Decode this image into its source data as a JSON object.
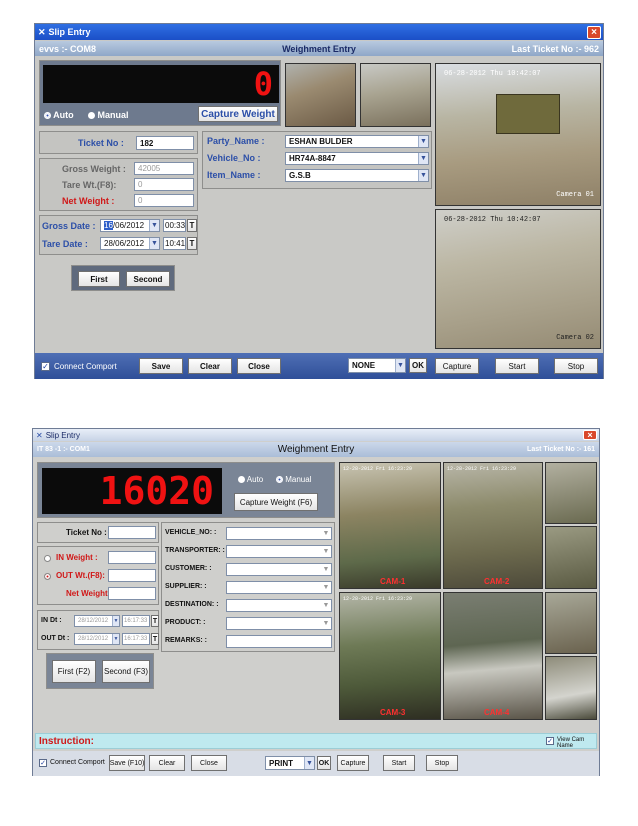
{
  "top": {
    "title": "Slip Entry",
    "header_left": "evvs :- COM8",
    "header_center": "Weighment Entry",
    "header_right": "Last Ticket No :- 962",
    "display_value": "0",
    "mode_auto": "Auto",
    "mode_manual": "Manual",
    "capture_weight": "Capture Weight",
    "ticket_label": "Ticket No :",
    "ticket_value": "182",
    "gross_label": "Gross Weight :",
    "gross_value": "42005",
    "tare_label": "Tare Wt.(F8):",
    "tare_value": "0",
    "net_label": "Net Weight :",
    "net_value": "0",
    "gross_date_label": "Gross Date :",
    "gross_date_day": "16",
    "gross_date_rest": "/06/2012",
    "gross_time": "00:33",
    "tare_date_label": "Tare Date :",
    "tare_date": "28/06/2012",
    "tare_time": "10:41",
    "t_btn": "T",
    "first": "First",
    "second": "Second",
    "party_label": "Party_Name :",
    "party_value": "ESHAN BULDER",
    "vehicle_label": "Vehicle_No :",
    "vehicle_value": "HR74A-8847",
    "item_label": "Item_Name :",
    "item_value": "G.S.B",
    "cam1_stamp": "06-28-2012 Thu 10:42:07",
    "cam1_name": "Camera 01",
    "cam2_stamp": "06-28-2012 Thu 10:42:07",
    "cam2_name": "Camera 02",
    "connect": "Connect Comport",
    "save": "Save",
    "clear": "Clear",
    "close": "Close",
    "printer": "NONE",
    "ok": "OK",
    "capture": "Capture",
    "start": "Start",
    "stop": "Stop"
  },
  "bottom": {
    "title": "Slip Entry",
    "header_left": "IT 83 -1 :- COM1",
    "header_center": "Weighment Entry",
    "header_right": "Last Ticket No :- 161",
    "display_value": "16020",
    "mode_auto": "Auto",
    "mode_manual": "Manual",
    "capture_weight": "Capture Weight (F6)",
    "ticket_label": "Ticket No :",
    "in_label": "IN Weight :",
    "out_label": "OUT Wt.(F8):",
    "net_label": "Net Weight :",
    "in_dt_label": "IN Dt :",
    "in_date": "28/12/2012",
    "in_time": "16:17:33",
    "out_dt_label": "OUT Dt :",
    "out_date": "28/12/2012",
    "out_time": "16:17:33",
    "t_btn": "T",
    "first": "First (F2)",
    "second": "Second (F3)",
    "fields": [
      "VEHICLE_NO: :",
      "TRANSPORTER: :",
      "CUSTOMER: :",
      "SUPPLIER: :",
      "DESTINATION: :",
      "PRODUCT: :",
      "REMARKS: :"
    ],
    "cam_labels": [
      "CAM-1",
      "CAM-2",
      "CAM-3",
      "CAM-4"
    ],
    "cam_stamp": "12-28-2012 Fri 16:23:29",
    "instruction": "Instruction:",
    "view_cam": "View Cam Name",
    "connect": "Connect Comport",
    "save": "Save (F10)",
    "clear": "Clear",
    "close": "Close",
    "printer": "PRINT",
    "ok": "OK",
    "capture": "Capture",
    "start": "Start",
    "stop": "Stop"
  },
  "colors": {
    "title_bar": "#1b4fc7",
    "display_text": "#f01212",
    "label_blue": "#2c4fa8",
    "label_red": "#d01818",
    "instruction_bg": "#bfe9ef"
  }
}
